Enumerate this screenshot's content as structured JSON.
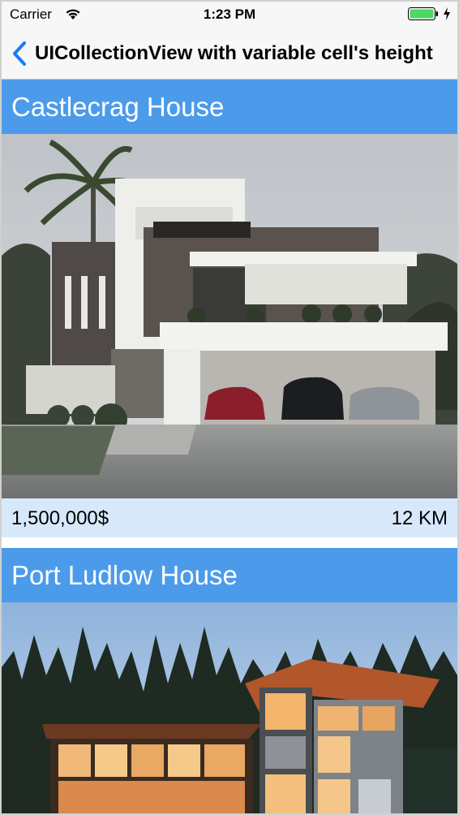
{
  "status_bar": {
    "carrier": "Carrier",
    "time": "1:23 PM",
    "battery_color": "#4cd964"
  },
  "nav_bar": {
    "back_icon": "chevron-left-icon",
    "title": "UICollectionView with variable cell's height",
    "accent_color": "#1a7cf5"
  },
  "cells": [
    {
      "title": "Castlecrag House",
      "price": "1,500,000$",
      "distance": "12 KM",
      "image": "modern-white-house-with-cars-photo"
    },
    {
      "title": "Port Ludlow House",
      "image": "modern-house-at-dusk-with-pine-trees-photo"
    }
  ],
  "colors": {
    "title_bar": "#4c9bea",
    "info_bar": "#d7e8fb"
  }
}
